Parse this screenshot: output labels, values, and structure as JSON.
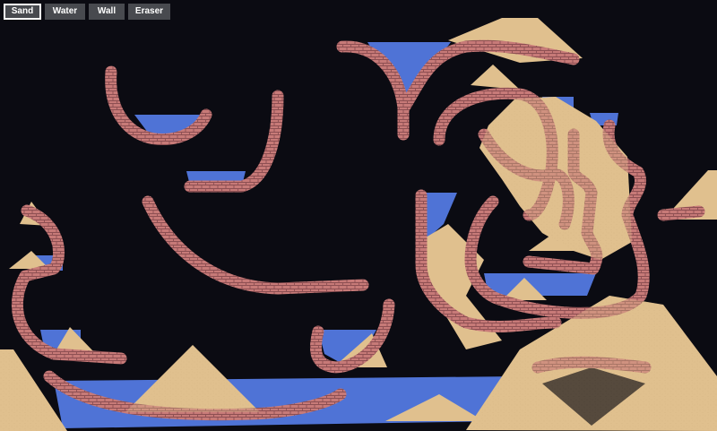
{
  "toolbar": {
    "tools": [
      {
        "label": "Sand",
        "selected": true
      },
      {
        "label": "Water",
        "selected": false
      },
      {
        "label": "Wall",
        "selected": false
      },
      {
        "label": "Eraser",
        "selected": false
      }
    ]
  },
  "colors": {
    "background": "#0b0b12",
    "sand": "#e0c08e",
    "sand_speck": "#c9a877",
    "water": "#4f73d6",
    "wall": "#c77a78",
    "wall_mortar": "#8d4f52",
    "button_bg": "#484a4f",
    "button_text": "#ffffff",
    "button_active_border": "#ffffff"
  }
}
